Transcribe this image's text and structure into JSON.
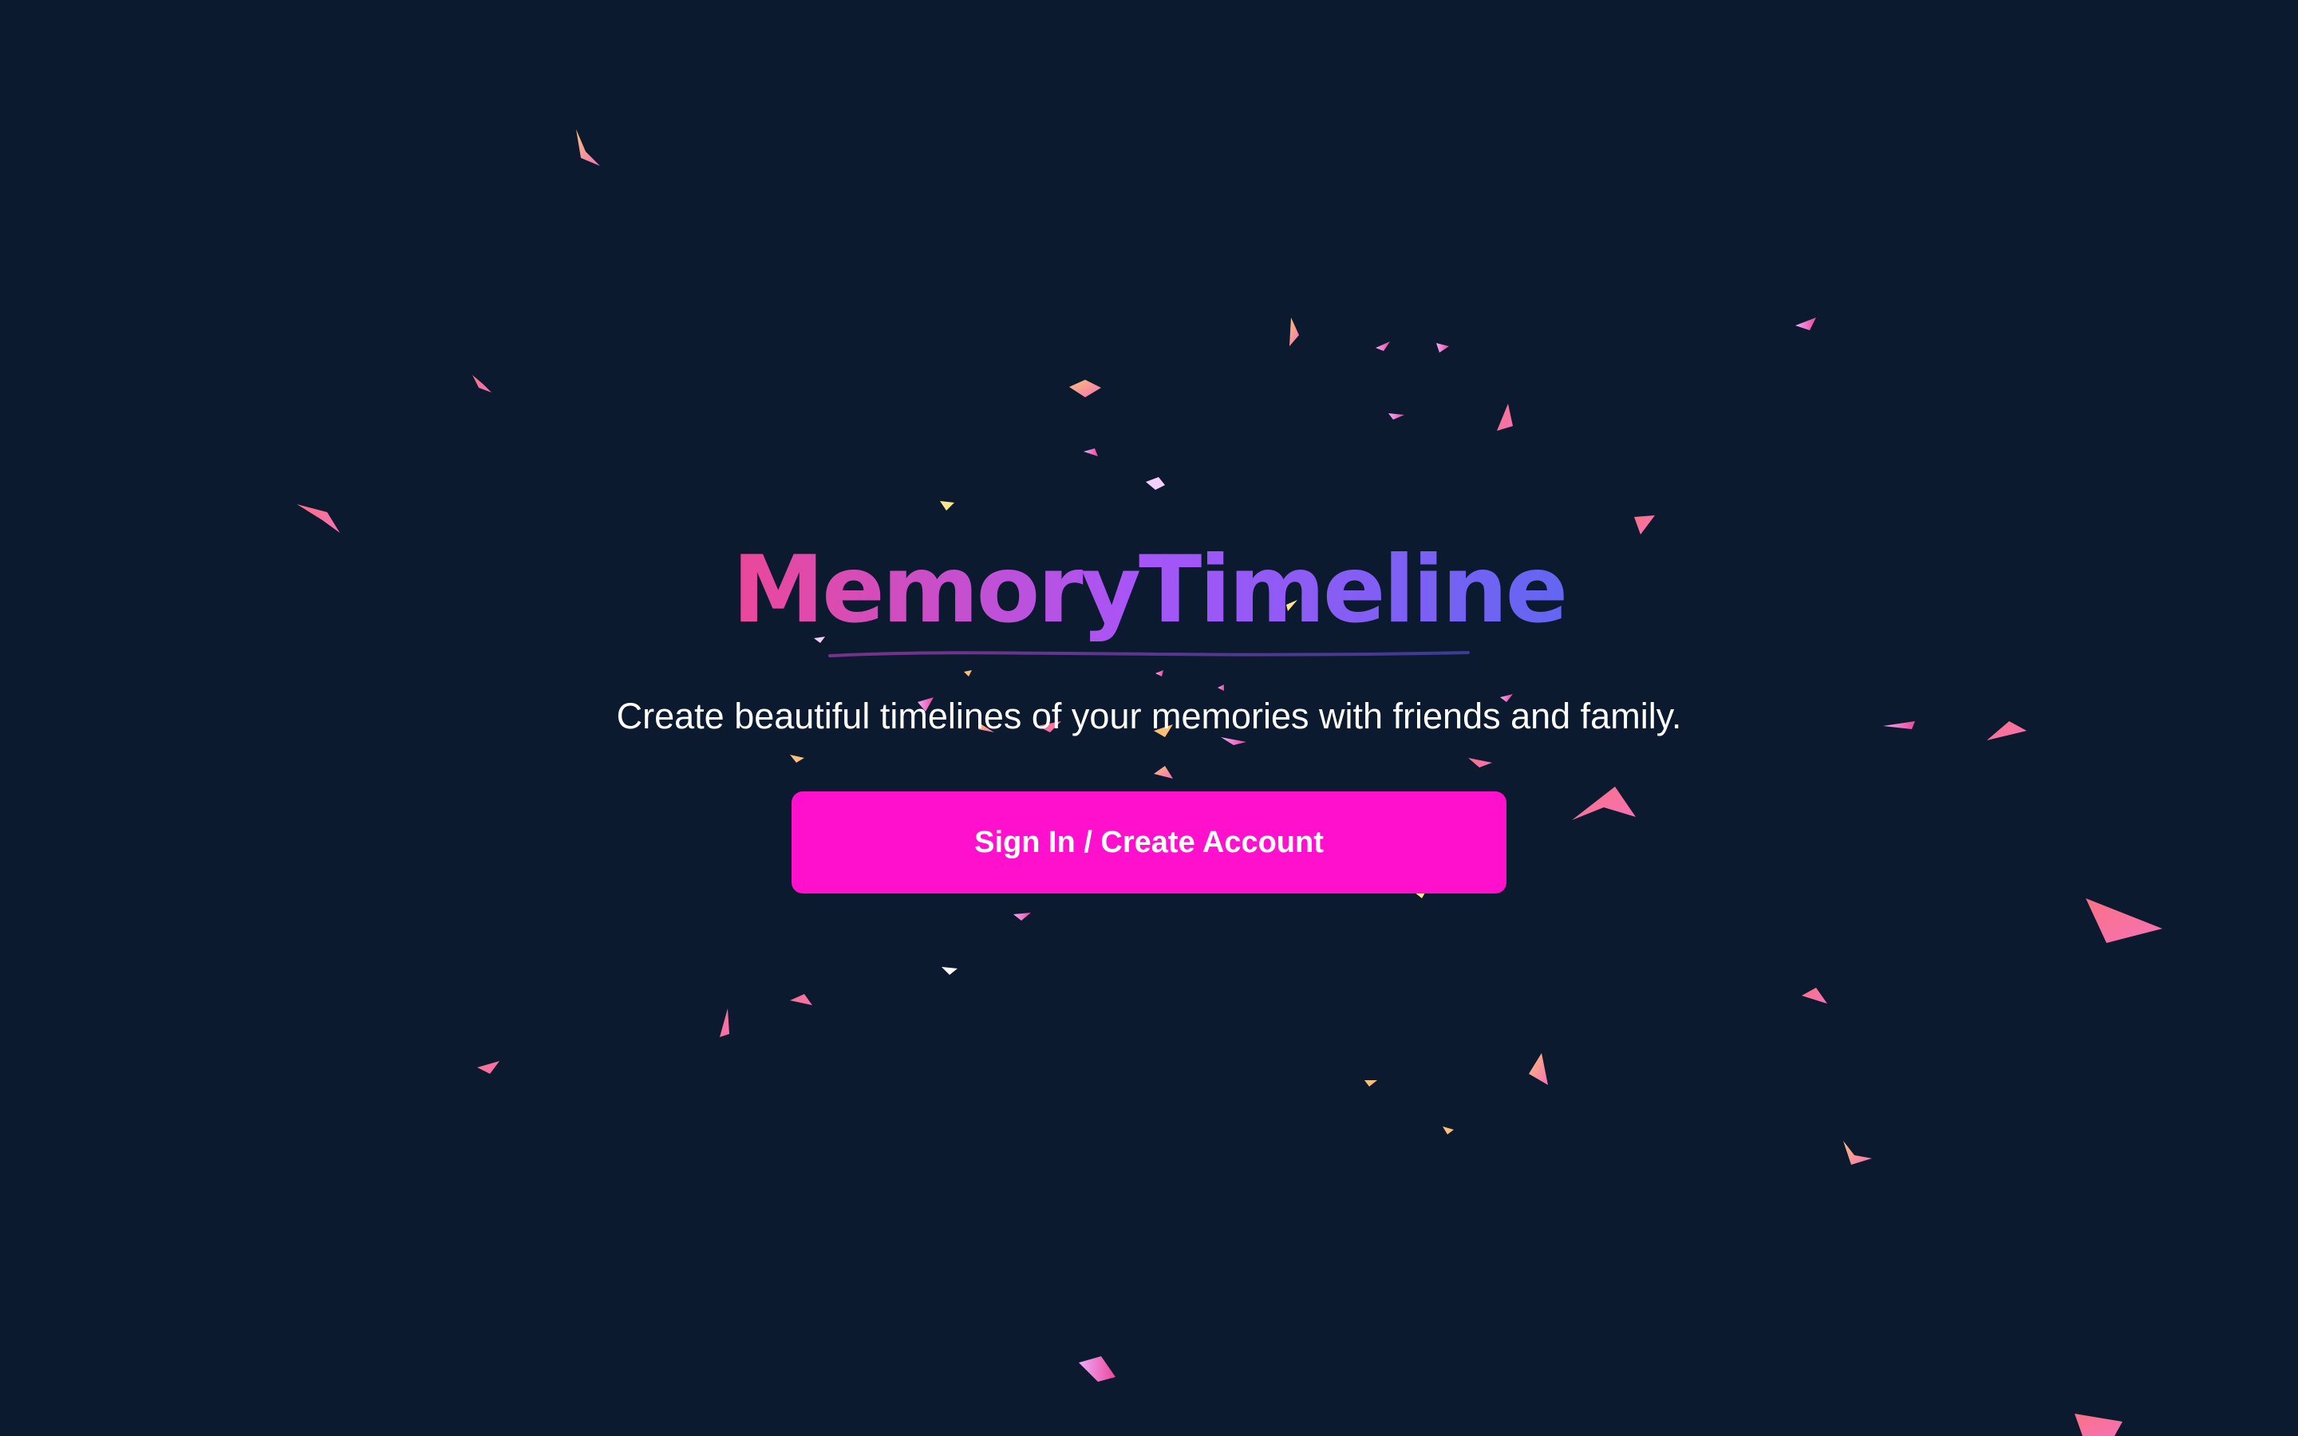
{
  "brand": {
    "title": "MemoryTimeline",
    "gradient_start": "#ec4899",
    "gradient_mid": "#a855f7",
    "gradient_end": "#6366f1"
  },
  "hero": {
    "subtitle": "Create beautiful timelines of your memories with friends and family.",
    "cta_label": "Sign In / Create Account"
  },
  "theme": {
    "background": "#0b1a2e",
    "cta_color": "#ff10cd",
    "text_color": "#ffffff"
  }
}
